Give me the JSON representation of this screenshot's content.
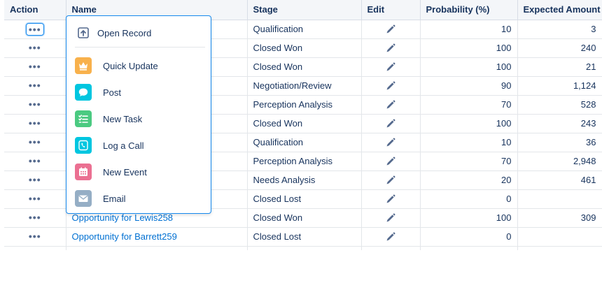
{
  "columns": {
    "action": "Action",
    "name": "Name",
    "stage": "Stage",
    "edit": "Edit",
    "probability": "Probability (%)",
    "expected_amount": "Expected Amount"
  },
  "rows": [
    {
      "name": "",
      "stage": "Qualification",
      "probability": "10",
      "amount": "3"
    },
    {
      "name": "",
      "stage": "Closed Won",
      "probability": "100",
      "amount": "240"
    },
    {
      "name": "",
      "stage": "Closed Won",
      "probability": "100",
      "amount": "21"
    },
    {
      "name": "",
      "stage": "Negotiation/Review",
      "probability": "90",
      "amount": "1,124"
    },
    {
      "name": "",
      "stage": "Perception Analysis",
      "probability": "70",
      "amount": "528"
    },
    {
      "name": "",
      "stage": "Closed Won",
      "probability": "100",
      "amount": "243"
    },
    {
      "name": "",
      "stage": "Qualification",
      "probability": "10",
      "amount": "36"
    },
    {
      "name": "",
      "stage": "Perception Analysis",
      "probability": "70",
      "amount": "2,948"
    },
    {
      "name": "",
      "stage": "Needs Analysis",
      "probability": "20",
      "amount": "461"
    },
    {
      "name": "",
      "stage": "Closed Lost",
      "probability": "0",
      "amount": ""
    },
    {
      "name": "Opportunity for Lewis258",
      "stage": "Closed Won",
      "probability": "100",
      "amount": "309"
    },
    {
      "name": "Opportunity for Barrett259",
      "stage": "Closed Lost",
      "probability": "0",
      "amount": ""
    }
  ],
  "action_menu": {
    "open_record": {
      "label": "Open Record",
      "icon": "open-record-icon"
    },
    "items": [
      {
        "label": "Quick Update",
        "icon": "crown-icon",
        "color": "#f8b14c"
      },
      {
        "label": "Post",
        "icon": "chat-bubble-icon",
        "color": "#00c6e0"
      },
      {
        "label": "New Task",
        "icon": "task-list-icon",
        "color": "#4bca81"
      },
      {
        "label": "Log a Call",
        "icon": "phone-icon",
        "color": "#00c6e0"
      },
      {
        "label": "New Event",
        "icon": "calendar-icon",
        "color": "#eb7092"
      },
      {
        "label": "Email",
        "icon": "envelope-icon",
        "color": "#95aec5"
      }
    ]
  }
}
